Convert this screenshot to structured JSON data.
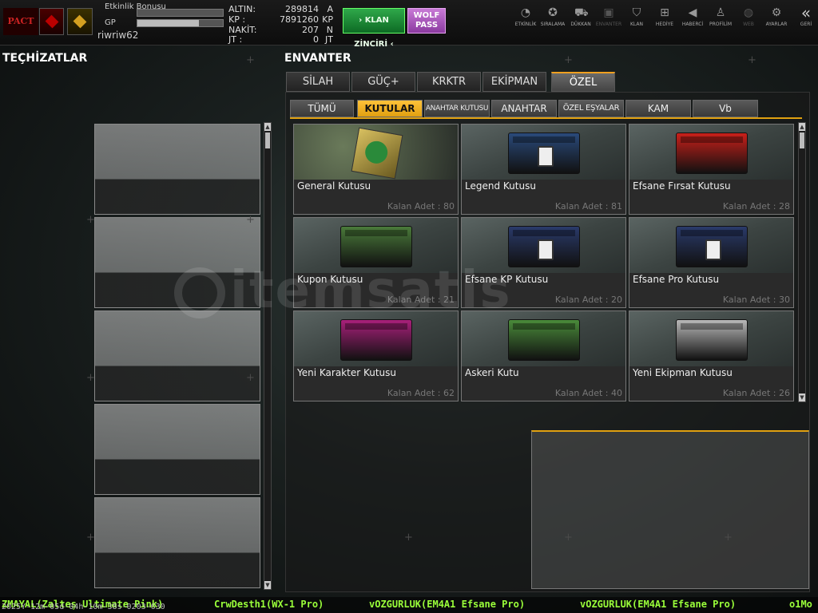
{
  "topbar": {
    "clan_emblem_text": "PACT",
    "bonus_label": "Etkinlik Bonusu",
    "gp_label": "GP",
    "bonus_progress": 0.0,
    "gp_progress": 0.72,
    "username": "riwriw62",
    "currencies": [
      {
        "key": "ALTIN:",
        "value": "289814",
        "unit": "A"
      },
      {
        "key": "KP  :",
        "value": "7891260",
        "unit": "KP"
      },
      {
        "key": "NAKİT:",
        "value": "207",
        "unit": "N"
      },
      {
        "key": "JT  :",
        "value": "0",
        "unit": "JT"
      }
    ],
    "klan_button": "KLAN ZİNCİRİ",
    "wolf_button_line1": "WOLF",
    "wolf_button_line2": "PASS",
    "nav": [
      {
        "label": "ETKİNLİK",
        "icon": "clock-icon",
        "glyph": "◔"
      },
      {
        "label": "SIRALAMA",
        "icon": "medal-icon",
        "glyph": "✪"
      },
      {
        "label": "DÜKKAN",
        "icon": "cart-icon",
        "glyph": "⛟"
      },
      {
        "label": "ENVANTER",
        "icon": "box-icon",
        "glyph": "▣"
      },
      {
        "label": "KLAN",
        "icon": "shield-icon",
        "glyph": "⛉"
      },
      {
        "label": "HEDİYE",
        "icon": "gift-icon",
        "glyph": "⊞"
      },
      {
        "label": "HABERCİ",
        "icon": "megaphone-icon",
        "glyph": "◀"
      },
      {
        "label": "PROFİLİM",
        "icon": "user-icon",
        "glyph": "♙"
      },
      {
        "label": "WEB",
        "icon": "globe-icon",
        "glyph": "◍"
      },
      {
        "label": "AYARLAR",
        "icon": "gear-icon",
        "glyph": "⚙"
      },
      {
        "label": "GERİ",
        "icon": "back-icon",
        "glyph": "«"
      }
    ]
  },
  "left": {
    "title": "TEÇHİZATLAR"
  },
  "inventory": {
    "title": "ENVANTER",
    "tabs": [
      "SİLAH",
      "GÜÇ+",
      "KRKTR",
      "EKİPMAN",
      "ÖZEL"
    ],
    "active_tab": "ÖZEL",
    "subtabs": [
      "TÜMÜ",
      "KUTULAR",
      "ANAHTAR KUTUSU",
      "ANAHTAR",
      "ÖZEL EŞYALAR",
      "KAM",
      "Vb"
    ],
    "active_subtab": "KUTULAR",
    "items": [
      {
        "name": "General Kutusu",
        "qty": "Kalan Adet : 80",
        "color": "#c8a040"
      },
      {
        "name": "Legend Kutusu",
        "qty": "Kalan Adet : 81",
        "color": "#2a4a7a"
      },
      {
        "name": "Efsane Fırsat Kutusu",
        "qty": "Kalan Adet : 28",
        "color": "#c8201a"
      },
      {
        "name": "Kupon Kutusu",
        "qty": "Kalan Adet : 21",
        "color": "#4a7a3a"
      },
      {
        "name": "Efsane KP Kutusu",
        "qty": "Kalan Adet : 20",
        "color": "#2a3a6a"
      },
      {
        "name": "Efsane Pro Kutusu",
        "qty": "Kalan Adet : 30",
        "color": "#2a3a6a"
      },
      {
        "name": "Yeni Karakter Kutusu",
        "qty": "Kalan Adet : 62",
        "color": "#a8207a"
      },
      {
        "name": "Askeri Kutu",
        "qty": "Kalan Adet : 40",
        "color": "#4a8a3a"
      },
      {
        "name": "Yeni Ekipman Kutusu",
        "qty": "Kalan Adet : 26",
        "color": "#b8b8b8"
      }
    ]
  },
  "watermark": "itemsatis",
  "ticker": {
    "clock": "2025Y-12m-05d-04h-10m-38s-0203-630",
    "messages": [
      "ZMAYAL(Zalteş Ultimate Pink)",
      "CrwDesth1(WX-1 Pro)",
      "vOZGURLUK(EM4A1 Efsane Pro)",
      "vOZGURLUK(EM4A1 Efsane Pro)",
      "o1Mo"
    ]
  }
}
